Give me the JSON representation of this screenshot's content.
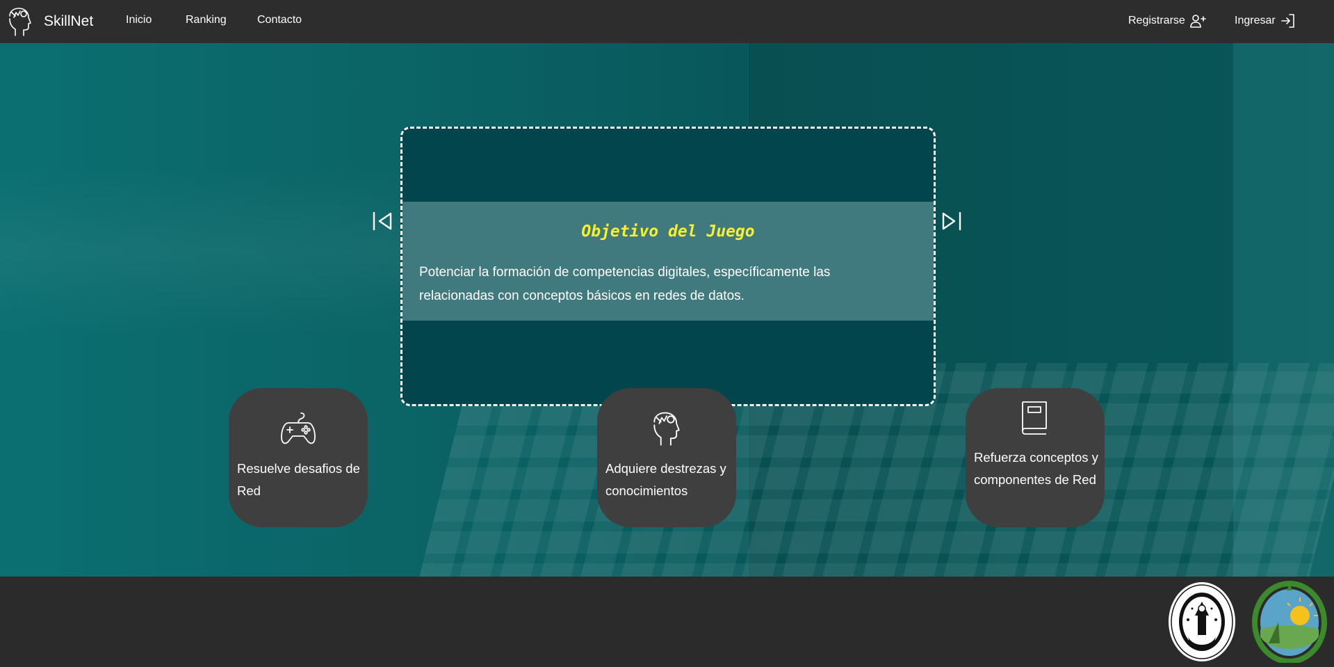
{
  "navbar": {
    "brand": "SkillNet",
    "links": [
      "Inicio",
      "Ranking",
      "Contacto"
    ],
    "register_label": "Registrarse",
    "login_label": "Ingresar",
    "icons": {
      "brand": "brain-head-icon",
      "register": "user-plus-icon",
      "login": "sign-in-icon"
    }
  },
  "carousel": {
    "title": "Objetivo del Juego",
    "text": "Potenciar la formación de competencias digitales, específicamente las relacionadas con conceptos básicos en redes de datos.",
    "prev_icon": "skip-previous-icon",
    "next_icon": "skip-next-icon"
  },
  "features": [
    {
      "icon": "gamepad-icon",
      "label": "Resuelve desafios de Red"
    },
    {
      "icon": "brain-head-icon",
      "label": "Adquiere destrezas y conocimientos"
    },
    {
      "icon": "book-icon",
      "label": "Refuerza conceptos y componentes de Red"
    }
  ],
  "footer": {
    "logos": [
      "university-seal",
      "province-seal"
    ]
  },
  "colors": {
    "navbar_bg": "#2d2d2d",
    "hero_teal": "#0b6466",
    "carousel_bg": "#03454c",
    "caption_bg": "#417a7e",
    "title_yellow": "#f7f12f",
    "card_bg": "#3f3f3f",
    "footer_bg": "#2b2b2b"
  }
}
